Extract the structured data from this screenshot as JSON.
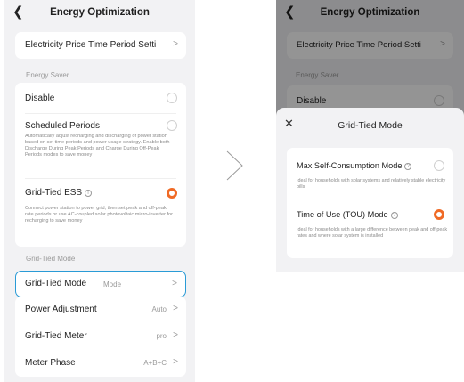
{
  "left_screen": {
    "back_icon": "chevron-left-icon",
    "title": "Energy Optimization",
    "electricity_price_row": {
      "label": "Electricity Price Time Period Setti",
      "chevron": ">"
    },
    "energy_saver_section": "Energy Saver",
    "disable_option": {
      "label": "Disable",
      "selected": false
    },
    "scheduled_option": {
      "label": "Scheduled Periods",
      "desc": "Automatically adjust recharging and discharging of power station based on set time periods and power usage strategy. Enable both Discharge During Peak Periods and Charge During Off-Peak Periods modes to save money",
      "selected": false
    },
    "grid_tied_ess_option": {
      "label": "Grid-Tied ESS",
      "info_icon": "info-circle-icon",
      "desc": "Connect power station to power grid, then set peak and off-peak rate periods or use AC-coupled solar photovoltaic micro-inverter for recharging to save money",
      "selected": true
    },
    "grid_tied_mode_section": "Grid-Tied Mode",
    "rows": [
      {
        "label": "Grid-Tied Mode",
        "value": "Mode",
        "chevron": ">"
      },
      {
        "label": "Power Adjustment",
        "value": "Auto",
        "chevron": ">"
      },
      {
        "label": "Grid-Tied Meter",
        "value": "pro",
        "chevron": ">"
      },
      {
        "label": "Meter Phase",
        "value": "A+B+C",
        "chevron": ">"
      }
    ],
    "accent_color": "#f06a25",
    "highlight_color": "#2a9bd6"
  },
  "right_screen": {
    "back_icon": "chevron-left-icon",
    "title": "Energy Optimization",
    "electricity_price_row": {
      "label": "Electricity Price Time Period Setti",
      "chevron": ">"
    },
    "energy_saver_section": "Energy Saver",
    "disable_label": "Disable",
    "sheet": {
      "close_icon": "close-icon",
      "title": "Grid-Tied Mode",
      "options": [
        {
          "label": "Max Self-Consumption Mode",
          "desc": "Ideal for households with solar systems and relatively stable electricity bills",
          "selected": false
        },
        {
          "label": "Time of Use (TOU) Mode",
          "desc": "Ideal for households with a large difference between peak and off-peak rates and where solar system is installed",
          "selected": true
        }
      ]
    }
  },
  "transition_icon": "chevron-right-arrow-icon"
}
